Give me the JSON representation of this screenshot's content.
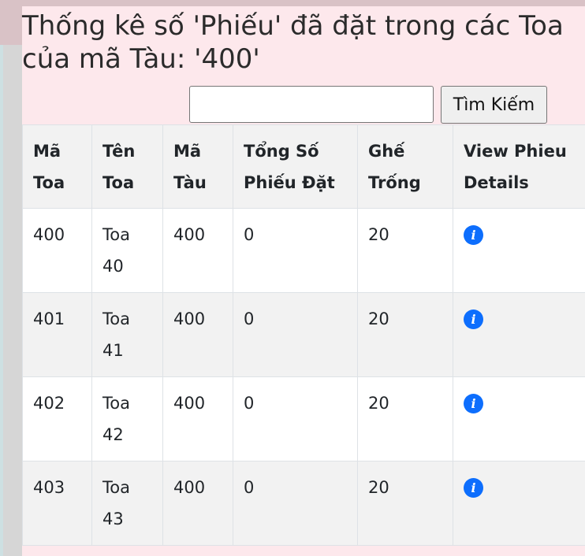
{
  "page": {
    "title": "Thống kê số 'Phiếu' đã đặt trong các Toa của mã Tàu: '400'"
  },
  "search": {
    "value": "",
    "placeholder": "",
    "button_label": "Tìm Kiếm"
  },
  "table": {
    "headers": [
      "Mã Toa",
      "Tên Toa",
      "Mã Tàu",
      "Tổng Số Phiếu Đặt",
      "Ghế Trống",
      "View Phieu Details"
    ],
    "rows": [
      {
        "ma_toa": "400",
        "ten_toa": "Toa 40",
        "ma_tau": "400",
        "tong_so_phieu": "0",
        "ghe_trong": "20",
        "action_icon": "info-icon"
      },
      {
        "ma_toa": "401",
        "ten_toa": "Toa 41",
        "ma_tau": "400",
        "tong_so_phieu": "0",
        "ghe_trong": "20",
        "action_icon": "info-icon"
      },
      {
        "ma_toa": "402",
        "ten_toa": "Toa 42",
        "ma_tau": "400",
        "tong_so_phieu": "0",
        "ghe_trong": "20",
        "action_icon": "info-icon"
      },
      {
        "ma_toa": "403",
        "ten_toa": "Toa 43",
        "ma_tau": "400",
        "tong_so_phieu": "0",
        "ghe_trong": "20",
        "action_icon": "info-icon"
      }
    ]
  },
  "colors": {
    "background": "#fde8ec",
    "info_icon": "#0d6efd",
    "header_bg": "#f2f2f2"
  }
}
